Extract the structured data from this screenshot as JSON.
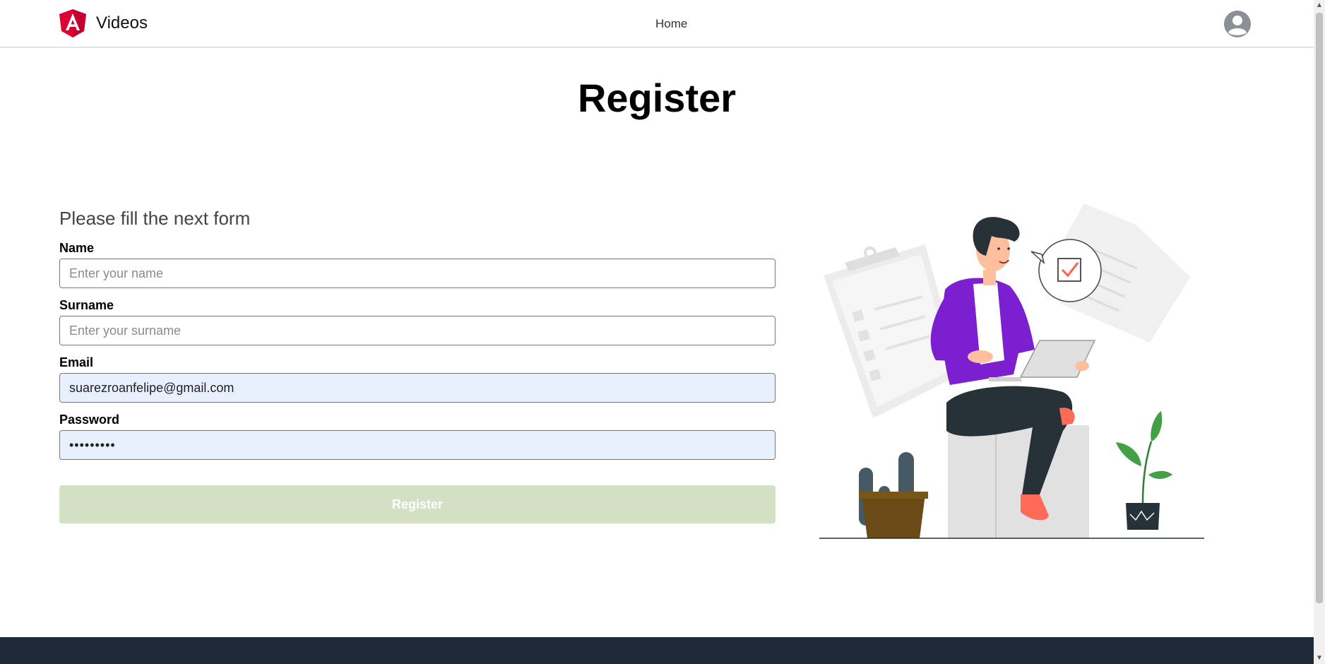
{
  "header": {
    "brand_name": "Videos",
    "nav_home": "Home",
    "brand_color": "#dd0031"
  },
  "page": {
    "title": "Register"
  },
  "form": {
    "subtitle": "Please fill the next form",
    "name": {
      "label": "Name",
      "placeholder": "Enter your name",
      "value": ""
    },
    "surname": {
      "label": "Surname",
      "placeholder": "Enter your surname",
      "value": ""
    },
    "email": {
      "label": "Email",
      "value": "suarezroanfelipe@gmail.com"
    },
    "password": {
      "label": "Password",
      "value": "•••••••••"
    },
    "submit_label": "Register"
  },
  "colors": {
    "accent_purple": "#7b1fd1",
    "button_disabled": "#d3e0c4",
    "footer": "#1f2937",
    "autofill": "#e8f0fe"
  },
  "icons": {
    "brand": "angular-logo-icon",
    "avatar": "user-avatar-icon"
  }
}
